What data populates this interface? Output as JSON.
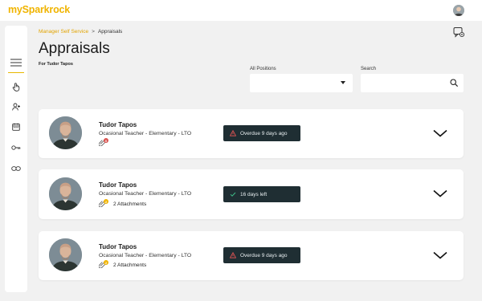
{
  "app": {
    "brand": "mySparkrock"
  },
  "sidebar": {
    "items": [
      {
        "icon": "hamburger-menu-icon"
      },
      {
        "icon": "hand-pointer-icon"
      },
      {
        "icon": "user-add-icon"
      },
      {
        "icon": "calendar-icon"
      },
      {
        "icon": "key-icon"
      },
      {
        "icon": "link-icon"
      }
    ]
  },
  "breadcrumb": {
    "parent": "Manager Self Service",
    "separator": ">",
    "current": "Appraisals"
  },
  "page": {
    "title": "Appraisals",
    "subtitle": "For Tudor Tapos"
  },
  "filters": {
    "positions_label": "All Positions",
    "positions_value": "",
    "search_label": "Search",
    "search_value": "",
    "search_placeholder": ""
  },
  "colors": {
    "brand": "#f0b400",
    "status_bg": "#1f2e33",
    "overdue": "#e25454",
    "ok": "#3fbf8a",
    "badge_red": "#d9534f",
    "badge_yellow": "#f0b400"
  },
  "appraisals": [
    {
      "name": "Tudor Tapos",
      "position": "Ocasional Teacher - Elementary - LTO",
      "attachments": "",
      "attachment_badge": "0",
      "status": "Overdue 9 days ago",
      "status_type": "overdue"
    },
    {
      "name": "Tudor Tapos",
      "position": "Ocasional Teacher - Elementary - LTO",
      "attachments": "2 Attachments",
      "attachment_badge": "2",
      "status": "16 days left",
      "status_type": "ok"
    },
    {
      "name": "Tudor Tapos",
      "position": "Ocasional Teacher - Elementary - LTO",
      "attachments": "2 Attachments",
      "attachment_badge": "2",
      "status": "Overdue 9 days ago",
      "status_type": "overdue"
    }
  ]
}
